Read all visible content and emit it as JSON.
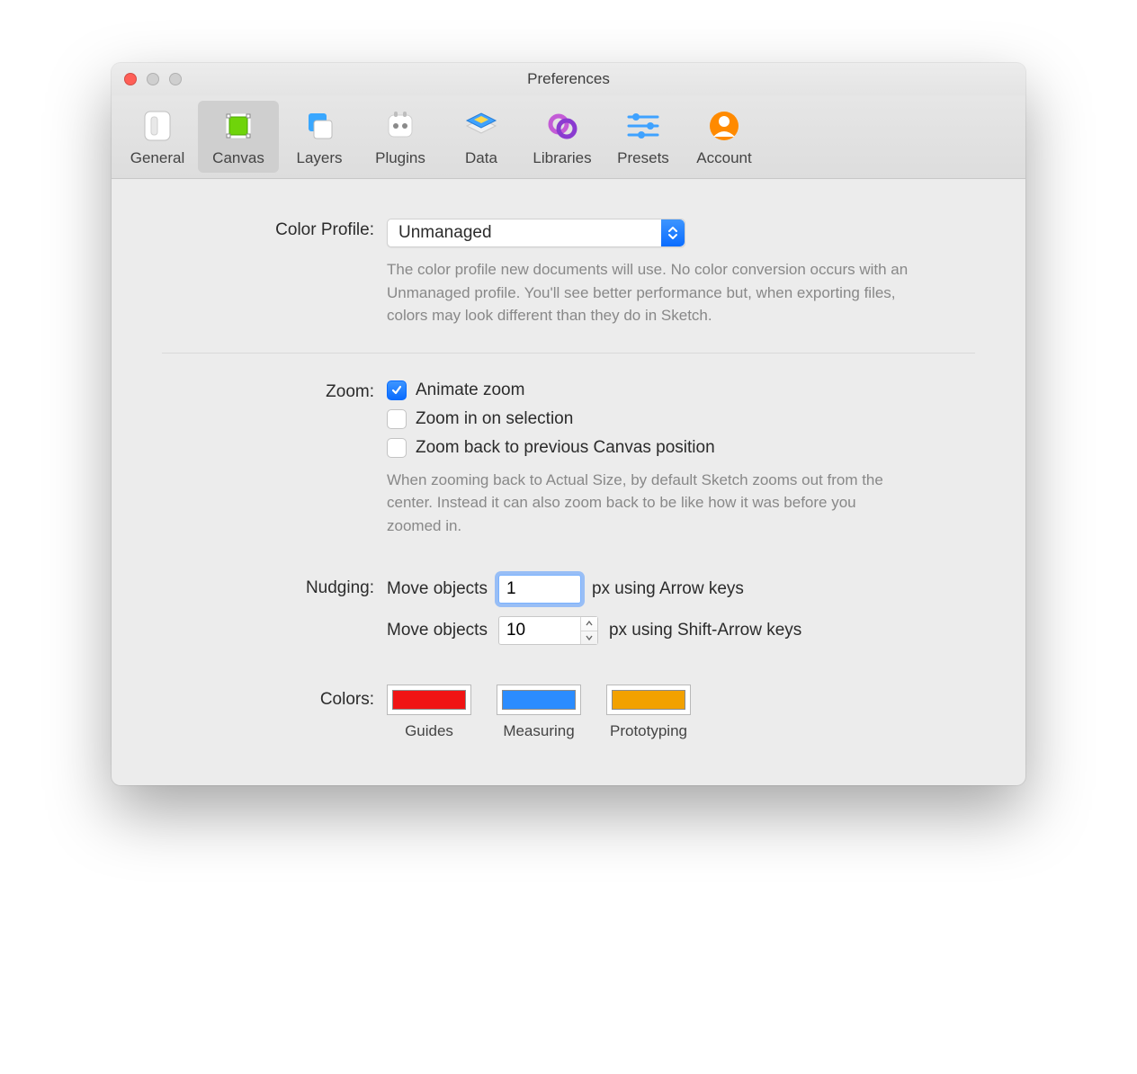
{
  "window": {
    "title": "Preferences"
  },
  "toolbar": {
    "items": [
      {
        "label": "General"
      },
      {
        "label": "Canvas",
        "selected": true
      },
      {
        "label": "Layers"
      },
      {
        "label": "Plugins"
      },
      {
        "label": "Data"
      },
      {
        "label": "Libraries"
      },
      {
        "label": "Presets"
      },
      {
        "label": "Account"
      }
    ]
  },
  "sections": {
    "color_profile": {
      "label": "Color Profile:",
      "value": "Unmanaged",
      "help": "The color profile new documents will use. No color conversion occurs with an Unmanaged profile. You'll see better performance but, when exporting files, colors may look different than they do in Sketch."
    },
    "zoom": {
      "label": "Zoom:",
      "animate": {
        "label": "Animate zoom",
        "checked": true
      },
      "on_selection": {
        "label": "Zoom in on selection",
        "checked": false
      },
      "back_prev": {
        "label": "Zoom back to previous Canvas position",
        "checked": false
      },
      "help": "When zooming back to Actual Size, by default Sketch zooms out from the center. Instead it can also zoom back to be like how it was before you zoomed in."
    },
    "nudging": {
      "label": "Nudging:",
      "prefix": "Move objects",
      "arrow_value": "1",
      "arrow_suffix": "px using Arrow keys",
      "shift_value": "10",
      "shift_suffix": "px using Shift-Arrow keys"
    },
    "colors": {
      "label": "Colors:",
      "items": [
        {
          "label": "Guides",
          "hex": "#f01414"
        },
        {
          "label": "Measuring",
          "hex": "#2b8cff"
        },
        {
          "label": "Prototyping",
          "hex": "#f2a100"
        }
      ]
    }
  }
}
